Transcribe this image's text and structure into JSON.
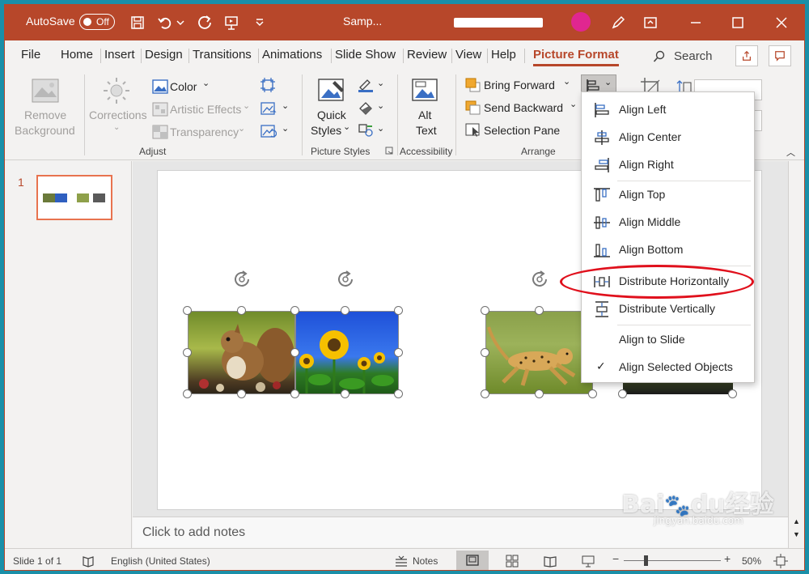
{
  "titlebar": {
    "autosave_label": "AutoSave",
    "autosave_state": "Off",
    "doc_title": "Samp...",
    "icons": [
      "save-icon",
      "undo-icon",
      "redo-icon",
      "present-icon",
      "customize-icon",
      "pen-icon",
      "ribbon-display-icon",
      "minimize-icon",
      "maximize-icon",
      "close-icon"
    ]
  },
  "tabs": [
    "File",
    "Home",
    "Insert",
    "Design",
    "Transitions",
    "Animations",
    "Slide Show",
    "Review",
    "View",
    "Help",
    "Picture Format"
  ],
  "search": {
    "label": "Search"
  },
  "ribbon": {
    "remove_background": [
      "Remove",
      "Background"
    ],
    "corrections": "Corrections",
    "color": "Color",
    "artistic_effects": "Artistic Effects",
    "transparency": "Transparency",
    "adjust_group": "Adjust",
    "quick_styles": [
      "Quick",
      "Styles"
    ],
    "picture_styles_group": "Picture Styles",
    "alt_text": [
      "Alt",
      "Text"
    ],
    "accessibility_group": "Accessibility",
    "bring_forward": "Bring Forward",
    "send_backward": "Send Backward",
    "selection_pane": "Selection Pane",
    "arrange_group": "Arrange"
  },
  "slide_panel": {
    "slide_number": "1"
  },
  "notes": {
    "placeholder": "Click to add notes"
  },
  "status": {
    "slide_info": "Slide 1 of 1",
    "language": "English (United States)",
    "notes_label": "Notes",
    "zoom": "50%",
    "zoom_level": 0.5
  },
  "align_menu": {
    "items": [
      {
        "label": "Align Left",
        "icon": "align-left-icon"
      },
      {
        "label": "Align Center",
        "icon": "align-center-icon"
      },
      {
        "label": "Align Right",
        "icon": "align-right-icon"
      },
      {
        "label": "Align Top",
        "icon": "align-top-icon"
      },
      {
        "label": "Align Middle",
        "icon": "align-middle-icon"
      },
      {
        "label": "Align Bottom",
        "icon": "align-bottom-icon"
      },
      {
        "label": "Distribute Horizontally",
        "icon": "distribute-horizontally-icon"
      },
      {
        "label": "Distribute Vertically",
        "icon": "distribute-vertically-icon"
      },
      {
        "label": "Align to Slide",
        "icon": ""
      },
      {
        "label": "Align Selected Objects",
        "icon": "checkmark-icon"
      }
    ],
    "highlighted": "Distribute Horizontally"
  },
  "colors": {
    "accent": "#b7472a",
    "highlight_ring": "#e0101c"
  },
  "watermark": {
    "logo": "Bai",
    "logo2": "du",
    "logo3": "经验",
    "url": "jingyan.baidu.com"
  }
}
